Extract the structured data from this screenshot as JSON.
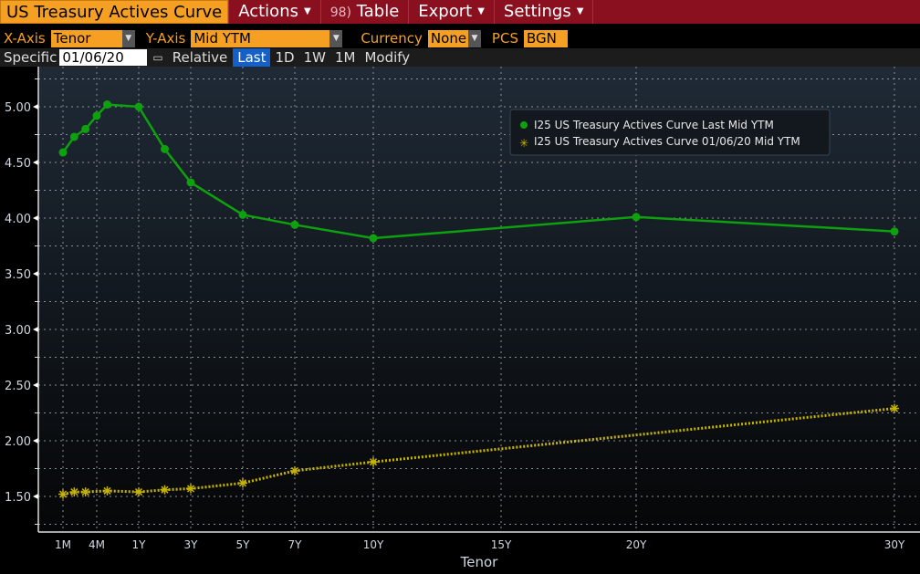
{
  "menubar": {
    "title": "US Treasury Actives Curve",
    "actions": "Actions",
    "table_num": "98)",
    "table": "Table",
    "export": "Export",
    "settings": "Settings"
  },
  "controls": {
    "xaxis_label": "X-Axis",
    "xaxis_value": "Tenor",
    "yaxis_label": "Y-Axis",
    "yaxis_value": "Mid YTM",
    "currency_label": "Currency",
    "currency_value": "None",
    "pcs_label": "PCS",
    "pcs_value": "BGN"
  },
  "toolbar": {
    "specific_label": "Specific",
    "date": "01/06/20",
    "relative_label": "Relative",
    "buttons": [
      "Last",
      "1D",
      "1W",
      "1M",
      "Modify"
    ],
    "active": "Last"
  },
  "chart_data": {
    "type": "line",
    "title": "US Treasury Actives Curve",
    "xlabel": "Tenor",
    "ylabel": "",
    "ylim": [
      1.25,
      5.3
    ],
    "yticks": [
      "1.50",
      "2.00",
      "2.50",
      "3.00",
      "3.50",
      "4.00",
      "4.50",
      "5.00"
    ],
    "xtick_labels": [
      "1M",
      "4M",
      "1Y",
      "3Y",
      "5Y",
      "7Y",
      "10Y",
      "15Y",
      "20Y",
      "30Y"
    ],
    "xtick_years": [
      0.0833,
      0.3333,
      1,
      3,
      5,
      7,
      10,
      15,
      20,
      30
    ],
    "grid": true,
    "legend_position": "top-right",
    "series": [
      {
        "name": "I25 US Treasury Actives Curve Last Mid YTM",
        "color": "#0ea00e",
        "marker": "circle",
        "style": "solid",
        "x_years": [
          0.0833,
          0.1667,
          0.25,
          0.3333,
          0.5,
          1,
          2,
          3,
          5,
          7,
          10,
          20,
          30
        ],
        "values": [
          4.59,
          4.73,
          4.8,
          4.92,
          5.02,
          5.0,
          4.62,
          4.32,
          4.03,
          3.94,
          3.82,
          4.01,
          3.88
        ]
      },
      {
        "name": "I25 US Treasury Actives Curve 01/06/20 Mid YTM",
        "color": "#c8b400",
        "marker": "asterisk",
        "style": "dotted",
        "x_years": [
          0.0833,
          0.1667,
          0.25,
          0.5,
          1,
          2,
          3,
          5,
          7,
          10,
          30
        ],
        "values": [
          1.52,
          1.54,
          1.54,
          1.55,
          1.54,
          1.56,
          1.57,
          1.62,
          1.73,
          1.81,
          2.29
        ]
      }
    ]
  }
}
